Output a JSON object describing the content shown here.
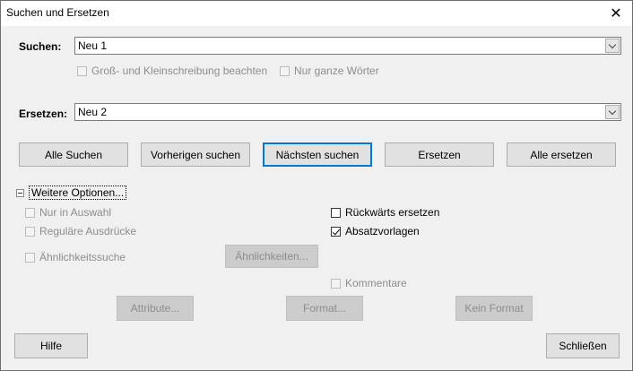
{
  "window": {
    "title": "Suchen und Ersetzen"
  },
  "search": {
    "label": "Suchen:",
    "value": "Neu 1"
  },
  "match_case": {
    "label": "Groß- und Kleinschreibung beachten",
    "checked": false
  },
  "whole_words": {
    "label": "Nur ganze Wörter",
    "checked": false
  },
  "replace": {
    "label": "Ersetzen:",
    "value": "Neu 2"
  },
  "actions": {
    "find_all": "Alle Suchen",
    "find_previous": "Vorherigen suchen",
    "find_next": "Nächsten suchen",
    "replace": "Ersetzen",
    "replace_all": "Alle ersetzen"
  },
  "more_options": {
    "label": "Weitere Optionen..."
  },
  "options": {
    "selection_only": {
      "label": "Nur in Auswahl",
      "checked": false
    },
    "regex": {
      "label": "Reguläre Ausdrücke",
      "checked": false
    },
    "similarity": {
      "label": "Ähnlichkeitssuche",
      "checked": false
    },
    "similarities_button": "Ähnlichkeiten...",
    "replace_backwards": {
      "label": "Rückwärts ersetzen",
      "checked": false
    },
    "paragraph_styles": {
      "label": "Absatzvorlagen",
      "checked": true
    },
    "comments": {
      "label": "Kommentare",
      "checked": false
    }
  },
  "format_buttons": {
    "attributes": "Attribute...",
    "format": "Format...",
    "no_format": "Kein Format"
  },
  "footer": {
    "help": "Hilfe",
    "close": "Schließen"
  }
}
